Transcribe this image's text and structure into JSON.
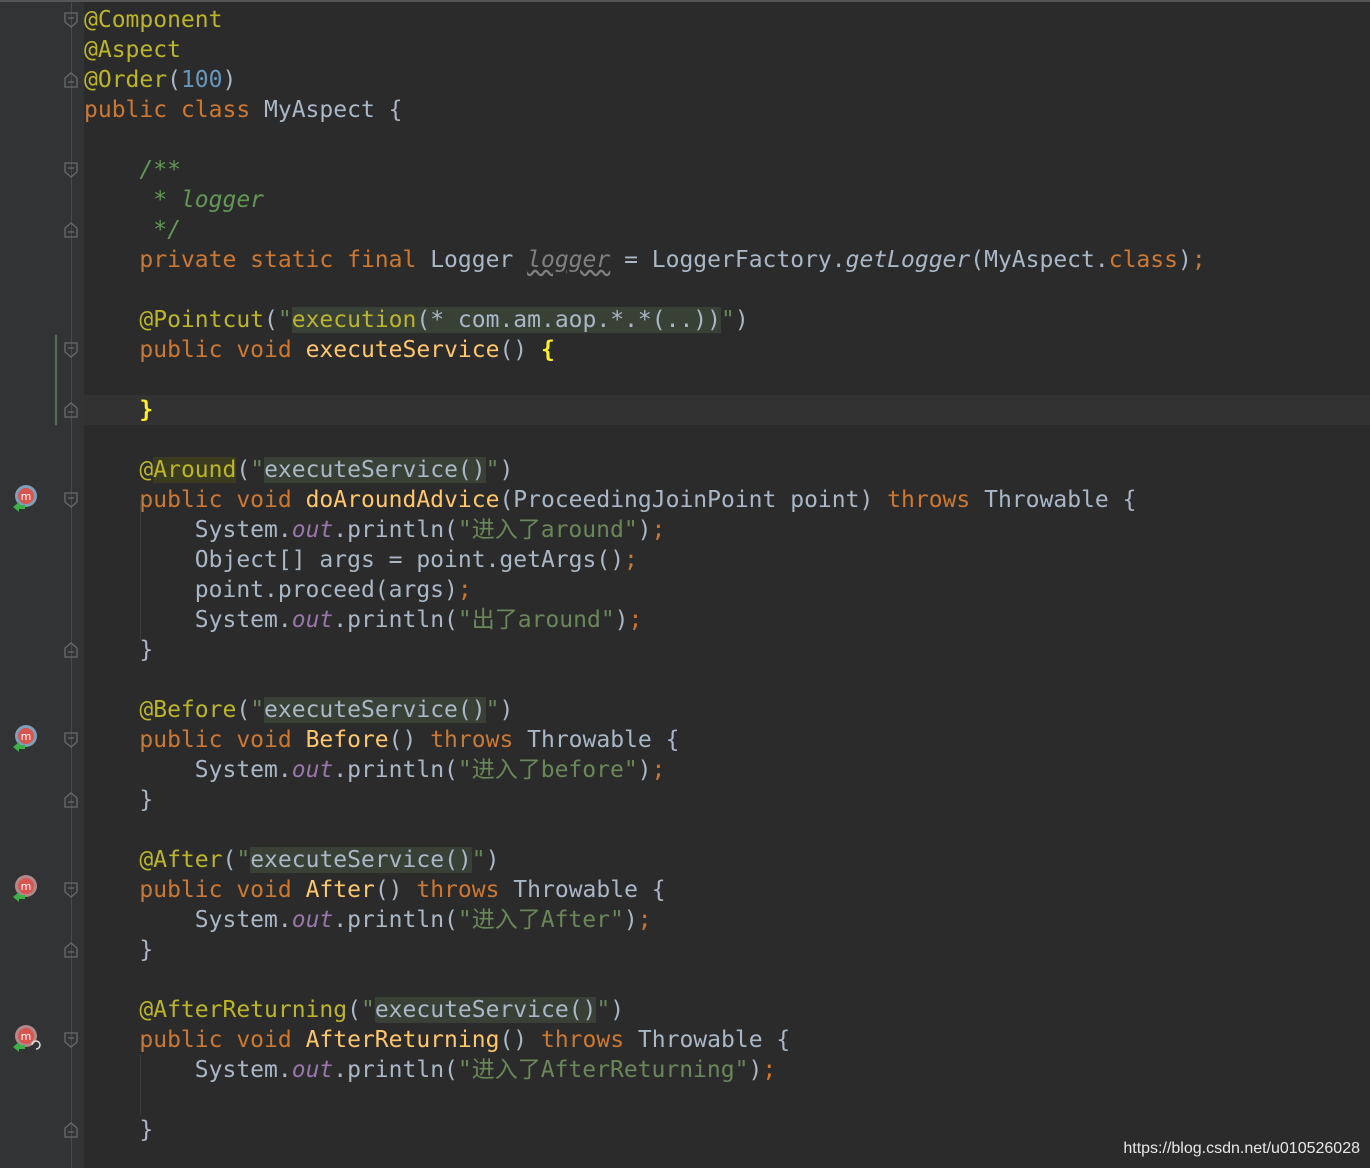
{
  "editor": {
    "lines": [
      {
        "t": 110,
        "ind": 0,
        "tok": [
          {
            "c": "an",
            "x": "@Component"
          }
        ]
      },
      {
        "t": 140,
        "ind": 0,
        "tok": [
          {
            "c": "an",
            "x": "@Aspect"
          }
        ]
      },
      {
        "t": 170,
        "ind": 0,
        "tok": [
          {
            "c": "an",
            "x": "@Order"
          },
          {
            "c": "",
            "x": "("
          },
          {
            "c": "num",
            "x": "100"
          },
          {
            "c": "",
            "x": ")"
          }
        ]
      },
      {
        "t": 200,
        "ind": 0,
        "tok": [
          {
            "c": "kw",
            "x": "public class "
          },
          {
            "c": "",
            "x": "MyAspect {"
          }
        ]
      },
      {
        "t": 230,
        "ind": 0,
        "tok": []
      },
      {
        "t": 260,
        "ind": 4,
        "tok": [
          {
            "c": "cm",
            "x": "/**"
          }
        ]
      },
      {
        "t": 290,
        "ind": 4,
        "tok": [
          {
            "c": "cm",
            "x": " * logger"
          }
        ]
      },
      {
        "t": 320,
        "ind": 4,
        "tok": [
          {
            "c": "cm",
            "x": " */"
          }
        ]
      },
      {
        "t": 350,
        "ind": 4,
        "tok": [
          {
            "c": "kw",
            "x": "private static final "
          },
          {
            "c": "",
            "x": "Logger "
          },
          {
            "c": "typo",
            "x": "logger"
          },
          {
            "c": "",
            "x": " = LoggerFactory."
          },
          {
            "c": "it",
            "x": "getLogger"
          },
          {
            "c": "",
            "x": "(MyAspect."
          },
          {
            "c": "kw",
            "x": "class"
          },
          {
            "c": "",
            "x": ")"
          },
          {
            "c": "kw",
            "x": ";"
          }
        ]
      },
      {
        "t": 380,
        "ind": 4,
        "tok": []
      },
      {
        "t": 410,
        "ind": 4,
        "tok": [
          {
            "c": "an",
            "x": "@Pointcut"
          },
          {
            "c": "",
            "x": "("
          },
          {
            "c": "str",
            "x": "\""
          },
          {
            "c": "an inj",
            "x": "execution"
          },
          {
            "c": "inj",
            "x": "(* com.am.aop.*.*(..))"
          },
          {
            "c": "str",
            "x": "\""
          },
          {
            "c": "",
            "x": ")"
          }
        ]
      },
      {
        "t": 440,
        "ind": 4,
        "tok": [
          {
            "c": "kw",
            "x": "public void "
          },
          {
            "c": "fn",
            "x": "executeService"
          },
          {
            "c": "",
            "x": "() "
          },
          {
            "c": "brace",
            "x": "{"
          }
        ]
      },
      {
        "t": 470,
        "ind": 4,
        "tok": []
      },
      {
        "t": 500,
        "ind": 4,
        "tok": [
          {
            "c": "brace",
            "x": "}"
          }
        ]
      },
      {
        "t": 530,
        "ind": 4,
        "tok": []
      },
      {
        "t": 560,
        "ind": 4,
        "tok": [
          {
            "c": "an",
            "x": "@"
          },
          {
            "c": "an hlann",
            "x": "Around"
          },
          {
            "c": "",
            "x": "("
          },
          {
            "c": "str",
            "x": "\""
          },
          {
            "c": "inj",
            "x": "executeService()"
          },
          {
            "c": "str",
            "x": "\""
          },
          {
            "c": "",
            "x": ")"
          }
        ]
      },
      {
        "t": 590,
        "ind": 4,
        "tok": [
          {
            "c": "kw",
            "x": "public void "
          },
          {
            "c": "fn",
            "x": "doAroundAdvice"
          },
          {
            "c": "",
            "x": "(ProceedingJoinPoint point) "
          },
          {
            "c": "kw",
            "x": "throws "
          },
          {
            "c": "",
            "x": "Throwable {"
          }
        ]
      },
      {
        "t": 620,
        "ind": 8,
        "tok": [
          {
            "c": "",
            "x": "System."
          },
          {
            "c": "st",
            "x": "out"
          },
          {
            "c": "",
            "x": ".println("
          },
          {
            "c": "str",
            "x": "\"进入了around\""
          },
          {
            "c": "",
            "x": ")"
          },
          {
            "c": "kw",
            "x": ";"
          }
        ]
      },
      {
        "t": 650,
        "ind": 8,
        "tok": [
          {
            "c": "",
            "x": "Object[] args = point.getArgs()"
          },
          {
            "c": "kw",
            "x": ";"
          }
        ]
      },
      {
        "t": 680,
        "ind": 8,
        "tok": [
          {
            "c": "",
            "x": "point.proceed(args)"
          },
          {
            "c": "kw",
            "x": ";"
          }
        ]
      },
      {
        "t": 710,
        "ind": 8,
        "tok": [
          {
            "c": "",
            "x": "System."
          },
          {
            "c": "st",
            "x": "out"
          },
          {
            "c": "",
            "x": ".println("
          },
          {
            "c": "str",
            "x": "\"出了around\""
          },
          {
            "c": "",
            "x": ")"
          },
          {
            "c": "kw",
            "x": ";"
          }
        ]
      },
      {
        "t": 740,
        "ind": 4,
        "tok": [
          {
            "c": "",
            "x": "}"
          }
        ]
      },
      {
        "t": 770,
        "ind": 4,
        "tok": []
      },
      {
        "t": 800,
        "ind": 4,
        "tok": [
          {
            "c": "an",
            "x": "@Before"
          },
          {
            "c": "",
            "x": "("
          },
          {
            "c": "str",
            "x": "\""
          },
          {
            "c": "inj",
            "x": "executeService()"
          },
          {
            "c": "str",
            "x": "\""
          },
          {
            "c": "",
            "x": ")"
          }
        ]
      },
      {
        "t": 830,
        "ind": 4,
        "tok": [
          {
            "c": "kw",
            "x": "public void "
          },
          {
            "c": "fn",
            "x": "Before"
          },
          {
            "c": "",
            "x": "() "
          },
          {
            "c": "kw",
            "x": "throws "
          },
          {
            "c": "",
            "x": "Throwable {"
          }
        ]
      },
      {
        "t": 860,
        "ind": 8,
        "tok": [
          {
            "c": "",
            "x": "System."
          },
          {
            "c": "st",
            "x": "out"
          },
          {
            "c": "",
            "x": ".println("
          },
          {
            "c": "str",
            "x": "\"进入了before\""
          },
          {
            "c": "",
            "x": ")"
          },
          {
            "c": "kw",
            "x": ";"
          }
        ]
      },
      {
        "t": 890,
        "ind": 4,
        "tok": [
          {
            "c": "",
            "x": "}"
          }
        ]
      },
      {
        "t": 920,
        "ind": 4,
        "tok": []
      },
      {
        "t": 950,
        "ind": 4,
        "tok": [
          {
            "c": "an",
            "x": "@After"
          },
          {
            "c": "",
            "x": "("
          },
          {
            "c": "str",
            "x": "\""
          },
          {
            "c": "inj",
            "x": "executeService()"
          },
          {
            "c": "str",
            "x": "\""
          },
          {
            "c": "",
            "x": ")"
          }
        ]
      },
      {
        "t": 980,
        "ind": 4,
        "tok": [
          {
            "c": "kw",
            "x": "public void "
          },
          {
            "c": "fn",
            "x": "After"
          },
          {
            "c": "",
            "x": "() "
          },
          {
            "c": "kw",
            "x": "throws "
          },
          {
            "c": "",
            "x": "Throwable {"
          }
        ]
      },
      {
        "t": 1010,
        "ind": 8,
        "tok": [
          {
            "c": "",
            "x": "System."
          },
          {
            "c": "st",
            "x": "out"
          },
          {
            "c": "",
            "x": ".println("
          },
          {
            "c": "str",
            "x": "\"进入了After\""
          },
          {
            "c": "",
            "x": ")"
          },
          {
            "c": "kw",
            "x": ";"
          }
        ]
      },
      {
        "t": 1040,
        "ind": 4,
        "tok": [
          {
            "c": "",
            "x": "}"
          }
        ]
      },
      {
        "t": 1070,
        "ind": 4,
        "tok": []
      },
      {
        "t": 1100,
        "ind": 4,
        "tok": [
          {
            "c": "an",
            "x": "@AfterReturning"
          },
          {
            "c": "",
            "x": "("
          },
          {
            "c": "str",
            "x": "\""
          },
          {
            "c": "inj",
            "x": "executeService()"
          },
          {
            "c": "str",
            "x": "\""
          },
          {
            "c": "",
            "x": ")"
          }
        ]
      },
      {
        "t": 1130,
        "ind": 4,
        "tok": [
          {
            "c": "kw",
            "x": "public void "
          },
          {
            "c": "fn",
            "x": "AfterReturning"
          },
          {
            "c": "",
            "x": "() "
          },
          {
            "c": "kw",
            "x": "throws "
          },
          {
            "c": "",
            "x": "Throwable {"
          }
        ]
      },
      {
        "t": 1160,
        "ind": 8,
        "tok": [
          {
            "c": "",
            "x": "System."
          },
          {
            "c": "st",
            "x": "out"
          },
          {
            "c": "",
            "x": ".println("
          },
          {
            "c": "str",
            "x": "\"进入了AfterReturning\""
          },
          {
            "c": "",
            "x": ")"
          },
          {
            "c": "kw",
            "x": ";"
          }
        ]
      },
      {
        "t": 1190,
        "ind": 4,
        "tok": []
      },
      {
        "t": 1220,
        "ind": 4,
        "tok": [
          {
            "c": "",
            "x": "}"
          }
        ]
      }
    ]
  },
  "gutter": {
    "method_markers": [
      "aspect-advice-icon",
      "aspect-advice-icon",
      "aspect-advice-icon",
      "aspect-advice-returning-icon"
    ]
  },
  "watermark": "https://blog.csdn.net/u010526028",
  "colors": {
    "background": "#2b2b2b",
    "keyword": "#cc7832",
    "annotation": "#bbb529",
    "string": "#6a8759",
    "number": "#6897bb",
    "comment": "#629755",
    "method": "#ffc66d",
    "static_field": "#9876aa"
  }
}
